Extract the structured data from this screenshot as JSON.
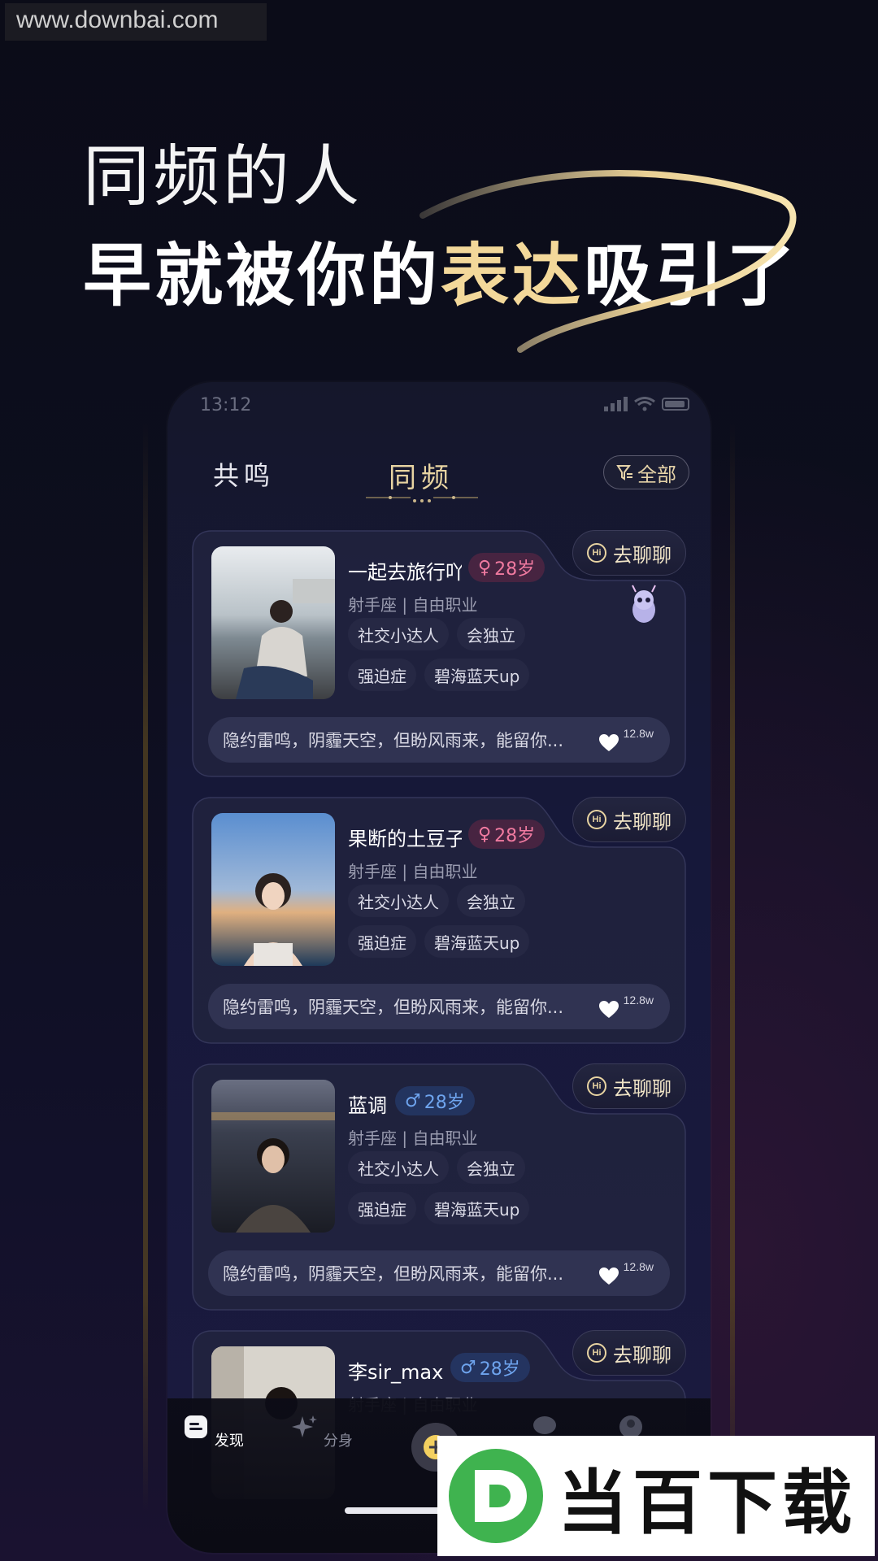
{
  "watermark": {
    "url": "www.downbai.com",
    "logo_text": "当百下载"
  },
  "headline": {
    "line1": "同频的人",
    "line2_pre": "早就被你的",
    "line2_highlight": "表达",
    "line2_post": "吸引了"
  },
  "status_bar": {
    "time": "13:12"
  },
  "top_tabs": {
    "left": "共鸣",
    "active": "同频",
    "filter": "全部"
  },
  "colors": {
    "gold": "#e8d4a2",
    "female": "#f07aa0",
    "male": "#6ea4ee"
  },
  "cards": [
    {
      "name": "一起去旅行吖",
      "gender": "female",
      "age": "28岁",
      "meta": "射手座 | 自由职业",
      "tags": [
        "社交小达人",
        "会独立",
        "强迫症",
        "碧海蓝天up"
      ],
      "quote": "隐约雷鸣，阴霾天空，但盼风雨来，能留你...",
      "likes": "12.8w",
      "chat": "去聊聊"
    },
    {
      "name": "果断的土豆子",
      "gender": "female",
      "age": "28岁",
      "meta": "射手座 | 自由职业",
      "tags": [
        "社交小达人",
        "会独立",
        "强迫症",
        "碧海蓝天up"
      ],
      "quote": "隐约雷鸣，阴霾天空，但盼风雨来，能留你...",
      "likes": "12.8w",
      "chat": "去聊聊"
    },
    {
      "name": "蓝调",
      "gender": "male",
      "age": "28岁",
      "meta": "射手座 | 自由职业",
      "tags": [
        "社交小达人",
        "会独立",
        "强迫症",
        "碧海蓝天up"
      ],
      "quote": "隐约雷鸣，阴霾天空，但盼风雨来，能留你...",
      "likes": "12.8w",
      "chat": "去聊聊"
    },
    {
      "name": "李sir_max",
      "gender": "male",
      "age": "28岁",
      "meta": "射手座 | 自由职业",
      "chat": "去聊聊"
    }
  ],
  "bottom_nav": [
    {
      "label": "发现",
      "icon": "discover-icon",
      "active": true
    },
    {
      "label": "分身",
      "icon": "sparkle-icon",
      "active": false
    },
    {
      "label": "",
      "icon": "plus-icon",
      "active": false
    },
    {
      "label": "",
      "icon": "message-icon",
      "active": false
    },
    {
      "label": "",
      "icon": "profile-icon",
      "active": false
    }
  ]
}
